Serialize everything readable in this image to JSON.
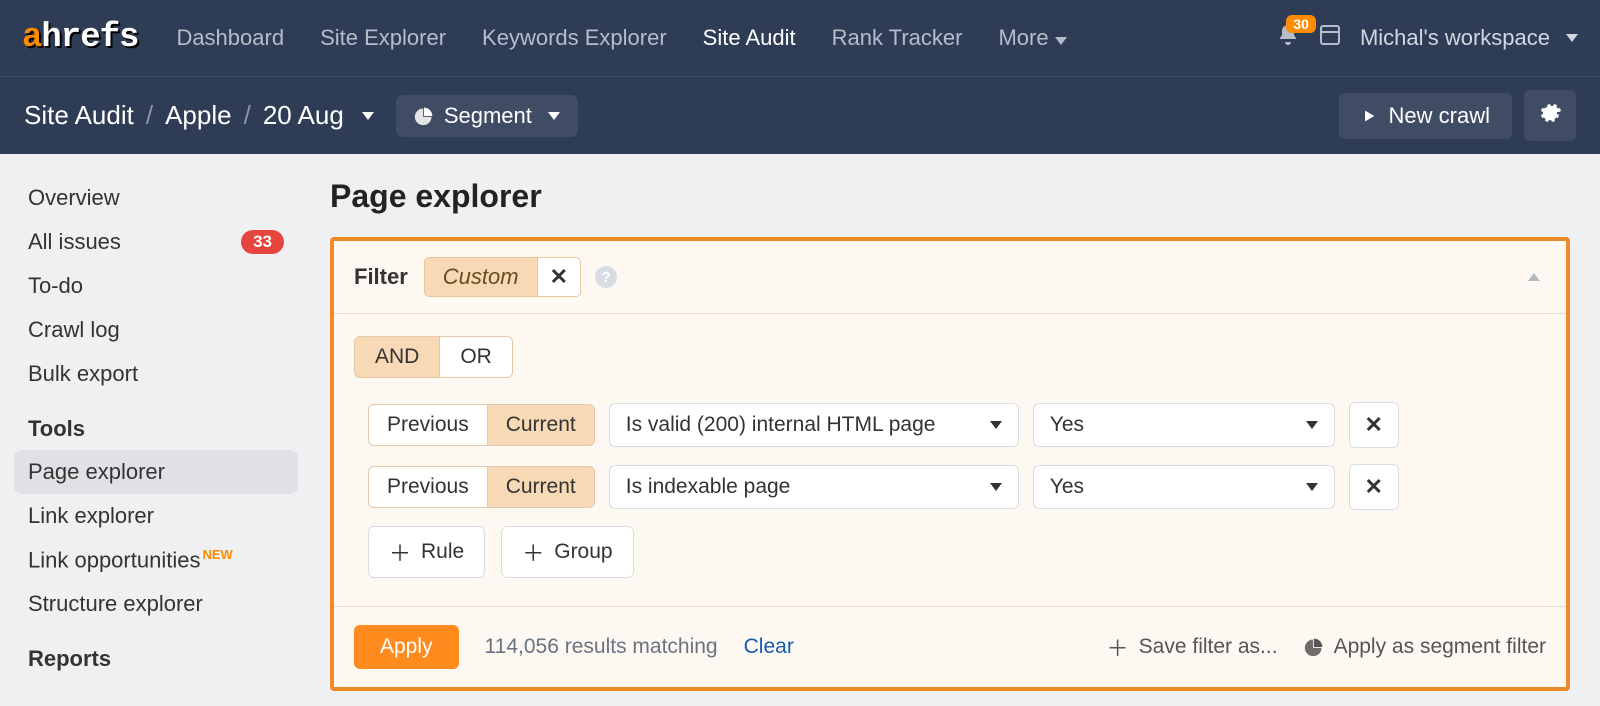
{
  "nav": {
    "items": [
      "Dashboard",
      "Site Explorer",
      "Keywords Explorer",
      "Site Audit",
      "Rank Tracker",
      "More"
    ],
    "active_index": 3,
    "notifications_count": "30",
    "workspace_label": "Michal's workspace"
  },
  "breadcrumb": {
    "root": "Site Audit",
    "project": "Apple",
    "date": "20 Aug",
    "segment_label": "Segment",
    "new_crawl_label": "New crawl"
  },
  "sidebar": {
    "items": [
      {
        "label": "Overview",
        "badge": ""
      },
      {
        "label": "All issues",
        "badge": "33"
      },
      {
        "label": "To-do",
        "badge": ""
      },
      {
        "label": "Crawl log",
        "badge": ""
      },
      {
        "label": "Bulk export",
        "badge": ""
      }
    ],
    "tools_header": "Tools",
    "tools": [
      {
        "label": "Page explorer",
        "active": true
      },
      {
        "label": "Link explorer",
        "active": false
      },
      {
        "label": "Link opportunities",
        "tag": "NEW",
        "active": false
      },
      {
        "label": "Structure explorer",
        "active": false
      }
    ],
    "reports_header": "Reports"
  },
  "page": {
    "title": "Page explorer"
  },
  "filter": {
    "label": "Filter",
    "chip": "Custom",
    "logic_options": [
      "AND",
      "OR"
    ],
    "logic_active": "AND",
    "rules": [
      {
        "scope_prev": "Previous",
        "scope_cur": "Current",
        "field": "Is valid (200) internal HTML page",
        "value": "Yes"
      },
      {
        "scope_prev": "Previous",
        "scope_cur": "Current",
        "field": "Is indexable page",
        "value": "Yes"
      }
    ],
    "add_rule": "Rule",
    "add_group": "Group",
    "apply": "Apply",
    "results_text": "114,056 results matching",
    "clear": "Clear",
    "save_as": "Save filter as...",
    "apply_segment": "Apply as segment filter"
  }
}
